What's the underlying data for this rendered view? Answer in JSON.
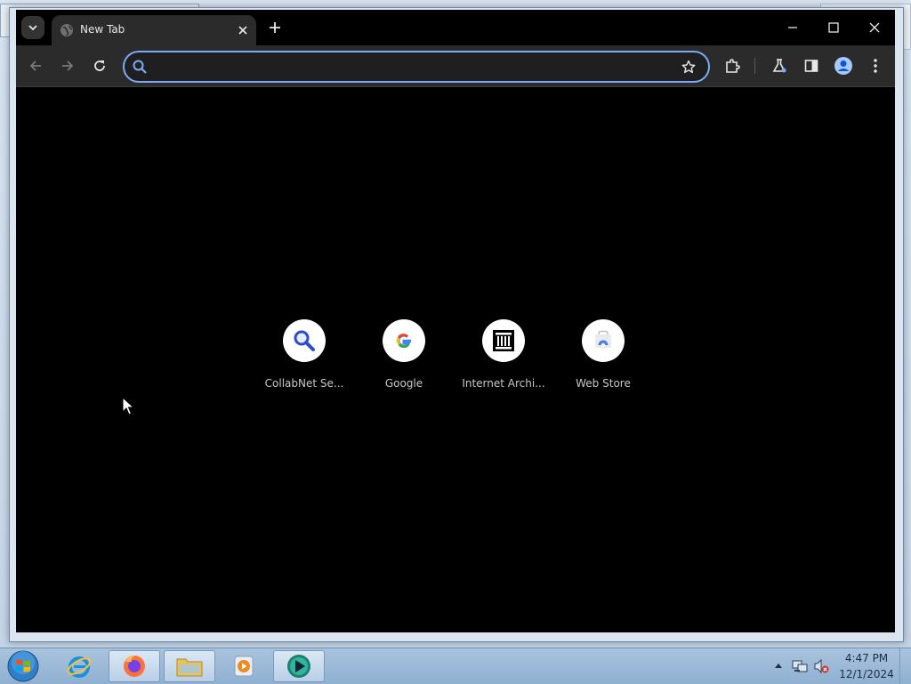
{
  "browser": {
    "tab": {
      "title": "New Tab"
    },
    "omnibox": {
      "value": "",
      "placeholder": ""
    },
    "colors": {
      "accent": "#7cacf8",
      "toolbar": "#2b2b2b",
      "page_bg": "#000000"
    }
  },
  "shortcuts": [
    {
      "label": "CollabNet Se...",
      "icon": "magnifier-icon"
    },
    {
      "label": "Google",
      "icon": "google-g-icon"
    },
    {
      "label": "Internet Archi...",
      "icon": "archive-building-icon"
    },
    {
      "label": "Web Store",
      "icon": "web-store-icon"
    }
  ],
  "taskbar": {
    "items": [
      "start-orb",
      "internet-explorer",
      "firefox",
      "file-explorer",
      "media-player",
      "active-app"
    ],
    "clock": {
      "time": "4:47 PM",
      "date": "12/1/2024"
    }
  }
}
